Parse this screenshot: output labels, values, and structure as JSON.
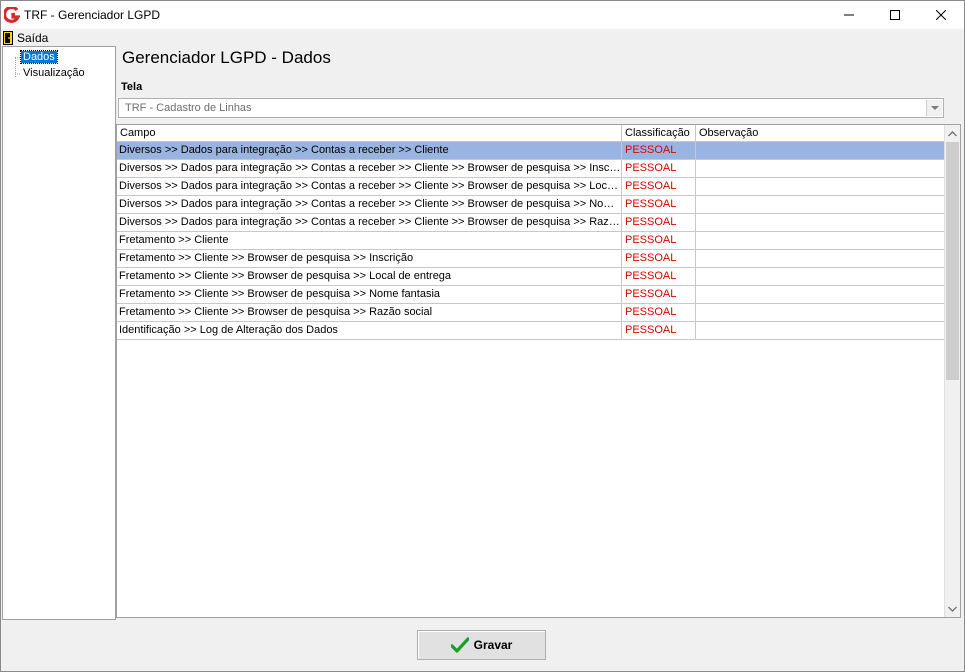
{
  "window": {
    "title": "TRF - Gerenciador LGPD",
    "minimize_label": "—",
    "maximize_label": "☐",
    "close_label": "✕"
  },
  "menu": {
    "exit_label": "Saída"
  },
  "tree": {
    "items": [
      {
        "label": "Dados",
        "selected": true
      },
      {
        "label": "Visualização",
        "selected": false
      }
    ]
  },
  "page": {
    "title": "Gerenciador LGPD - Dados",
    "tela_label": "Tela",
    "tela_value": "TRF - Cadastro de Linhas"
  },
  "grid": {
    "columns": [
      "Campo",
      "Classificação",
      "Observação"
    ],
    "rows": [
      {
        "campo": "Diversos >> Dados para integração >> Contas a receber >> Cliente",
        "classificacao": "PESSOAL",
        "observacao": ""
      },
      {
        "campo": "Diversos >> Dados para integração >> Contas a receber >> Cliente >> Browser de pesquisa >> Inscrição",
        "classificacao": "PESSOAL",
        "observacao": ""
      },
      {
        "campo": "Diversos >> Dados para integração >> Contas a receber >> Cliente >> Browser de pesquisa >> Local de...",
        "classificacao": "PESSOAL",
        "observacao": ""
      },
      {
        "campo": "Diversos >> Dados para integração >> Contas a receber >> Cliente >> Browser de pesquisa >> Nome fa...",
        "classificacao": "PESSOAL",
        "observacao": ""
      },
      {
        "campo": "Diversos >> Dados para integração >> Contas a receber >> Cliente >> Browser de pesquisa >> Razão s...",
        "classificacao": "PESSOAL",
        "observacao": ""
      },
      {
        "campo": "Fretamento >> Cliente",
        "classificacao": "PESSOAL",
        "observacao": ""
      },
      {
        "campo": "Fretamento >> Cliente >> Browser de pesquisa >> Inscrição",
        "classificacao": "PESSOAL",
        "observacao": ""
      },
      {
        "campo": "Fretamento >> Cliente >> Browser de pesquisa >> Local de entrega",
        "classificacao": "PESSOAL",
        "observacao": ""
      },
      {
        "campo": "Fretamento >> Cliente >> Browser de pesquisa >> Nome fantasia",
        "classificacao": "PESSOAL",
        "observacao": ""
      },
      {
        "campo": "Fretamento >> Cliente >> Browser de pesquisa >> Razão social",
        "classificacao": "PESSOAL",
        "observacao": ""
      },
      {
        "campo": "Identificação >> Log de Alteração dos Dados",
        "classificacao": "PESSOAL",
        "observacao": ""
      }
    ],
    "selected_row": 0
  },
  "footer": {
    "save_label": "Gravar"
  },
  "colors": {
    "selection": "#99b4e1",
    "classification_text": "#e00000",
    "tree_selection": "#0078d7"
  },
  "icons": {
    "app": "app-logo-icon",
    "exit": "exit-door-icon",
    "save": "checkmark-icon"
  }
}
